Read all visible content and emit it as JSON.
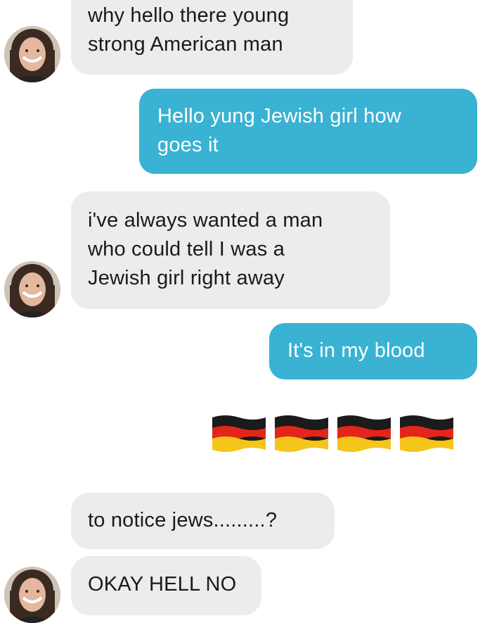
{
  "conversation": {
    "messages": [
      {
        "sender": "them",
        "lines": [
          "why hello there young",
          "strong American man"
        ]
      },
      {
        "sender": "me",
        "lines": [
          "Hello yung Jewish girl how",
          "goes it"
        ]
      },
      {
        "sender": "them",
        "lines": [
          "i've always wanted a man",
          "who could tell I was a",
          "Jewish girl right away"
        ]
      },
      {
        "sender": "me",
        "lines": [
          "It's in my blood"
        ]
      },
      {
        "sender": "me",
        "emoji": [
          "german-flag",
          "german-flag",
          "german-flag",
          "german-flag"
        ]
      },
      {
        "sender": "them",
        "lines": [
          "to notice jews.........?"
        ]
      },
      {
        "sender": "them",
        "lines": [
          "OKAY HELL NO"
        ]
      }
    ]
  },
  "colors": {
    "incoming_bubble": "#ececee",
    "outgoing_bubble": "#39b2d3",
    "incoming_text": "#1a1a1a",
    "outgoing_text": "#ffffff",
    "flag_black": "#1b1b1b",
    "flag_red": "#e2261c",
    "flag_gold": "#f4c51a"
  }
}
